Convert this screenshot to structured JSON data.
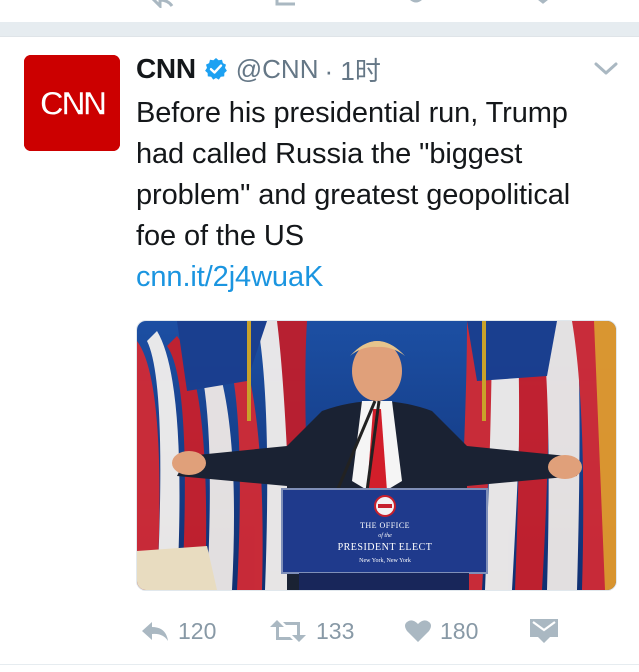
{
  "tweet": {
    "name": "CNN",
    "handle": "@CNN",
    "time": "· 1时",
    "text": "Before his presidential run, Trump had called Russia the \"biggest problem\" and greatest geopolitical foe of the US",
    "link": "cnn.it/2j4wuaK",
    "avatar_logo": "CNN",
    "media": {
      "podium_line1": "THE OFFICE",
      "podium_line2": "of the",
      "podium_line3": "PRESIDENT ELECT",
      "podium_line4": "New York, New York"
    },
    "actions": {
      "reply_count": "120",
      "retweet_count": "133",
      "like_count": "180"
    }
  },
  "icons": {
    "verified": "verified-badge-icon",
    "chevron": "chevron-down-icon",
    "reply": "reply-icon",
    "retweet": "retweet-icon",
    "like": "heart-icon",
    "dm": "direct-message-icon"
  },
  "colors": {
    "cnn_red": "#cc0000",
    "link_blue": "#1b95e0",
    "verified_blue": "#1da1f2",
    "icon_gray": "#8899a6"
  }
}
